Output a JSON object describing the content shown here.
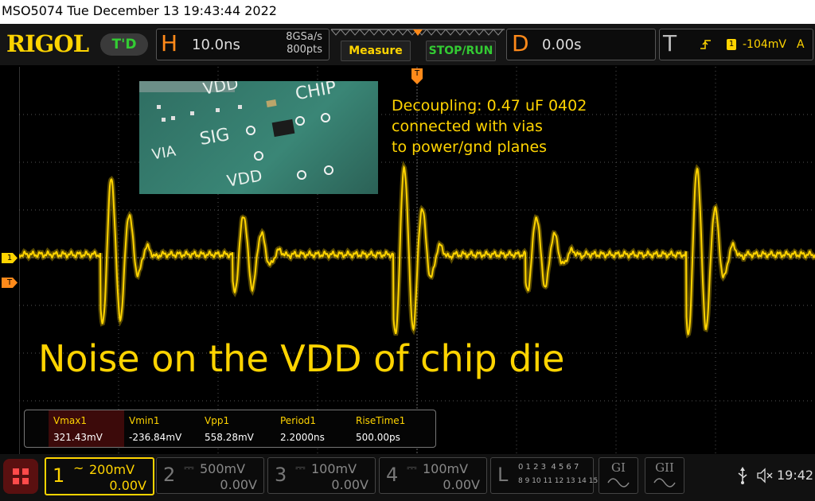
{
  "status_bar": {
    "text": "MSO5074  Tue December 13 19:43:44 2022"
  },
  "header": {
    "logo": "RIGOL",
    "mode": "T'D",
    "horizontal": {
      "letter": "H",
      "timebase": "10.0ns",
      "sample_rate": "8GSa/s",
      "points": "800pts"
    },
    "measure_label": "Measure",
    "stop_run_label": "STOP/RUN",
    "delay": {
      "letter": "D",
      "value": "0.00s"
    },
    "trigger": {
      "letter": "T",
      "channel": "1",
      "level": "-104mV",
      "mode": "A"
    }
  },
  "markers": {
    "channel1": "1",
    "trigger": "T",
    "trigger_top": "T"
  },
  "annotation": {
    "line1": "Decoupling: 0.47 uF 0402",
    "line2": "connected with vias",
    "line3": "to power/gnd planes"
  },
  "board_photo": {
    "labels": [
      "VDD",
      "CHIP",
      "SIG",
      "VIA",
      "VDD"
    ]
  },
  "caption": "Noise on the VDD of chip die",
  "measurements": [
    {
      "name": "Vmax1",
      "value": "321.43mV"
    },
    {
      "name": "Vmin1",
      "value": "-236.84mV"
    },
    {
      "name": "Vpp1",
      "value": "558.28mV"
    },
    {
      "name": "Period1",
      "value": "2.2000ns"
    },
    {
      "name": "RiseTime1",
      "value": "500.00ps"
    }
  ],
  "channels": [
    {
      "num": "1",
      "scale": "200mV",
      "offset": "0.00V",
      "coupling": "~",
      "color": "#ffd400",
      "active": true
    },
    {
      "num": "2",
      "scale": "500mV",
      "offset": "0.00V",
      "coupling": "⎓",
      "color": "#888888",
      "active": false
    },
    {
      "num": "3",
      "scale": "100mV",
      "offset": "0.00V",
      "coupling": "⎓",
      "color": "#888888",
      "active": false
    },
    {
      "num": "4",
      "scale": "100mV",
      "offset": "0.00V",
      "coupling": "⎓",
      "color": "#888888",
      "active": false
    }
  ],
  "logic": {
    "letter": "L",
    "row1": "0 1 2 3  4 5 6 7",
    "row2": "8 9 10 11 12 13 14 15"
  },
  "gen1": "GI",
  "gen2": "GII",
  "clock": "19:42",
  "colors": {
    "trace": "#ffd400",
    "accent": "#ff8a1a",
    "button_text": "#33cc33"
  },
  "icons": {
    "usb": "usb-icon",
    "sound": "speaker-muted-icon",
    "menu": "menu-icon"
  }
}
